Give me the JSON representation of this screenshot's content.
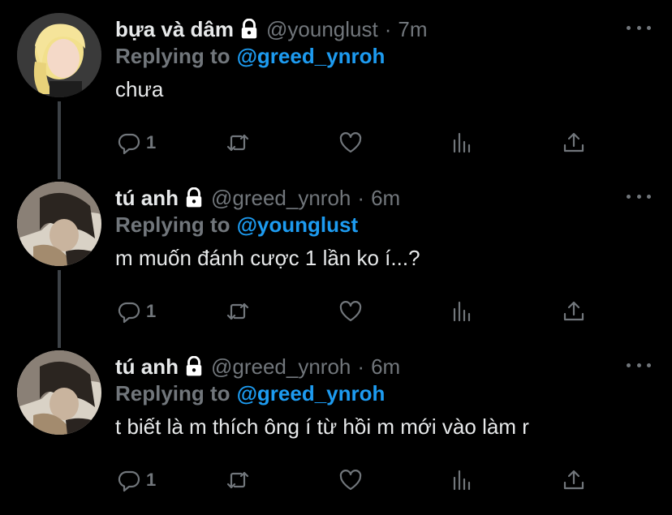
{
  "tweets": [
    {
      "display_name": "bựa và dâm",
      "handle": "@younglust",
      "time": "7m",
      "replying_label": "Replying to",
      "replying_to": "@greed_ynroh",
      "text": "chưa",
      "reply_count": "1",
      "avatar": "blonde-person-avatar"
    },
    {
      "display_name": "tú anh",
      "handle": "@greed_ynroh",
      "time": "6m",
      "replying_label": "Replying to",
      "replying_to": "@younglust",
      "text": "m muốn đánh cược 1 lần ko í...?",
      "reply_count": "1",
      "avatar": "dark-hair-person-avatar"
    },
    {
      "display_name": "tú anh",
      "handle": "@greed_ynroh",
      "time": "6m",
      "replying_label": "Replying to",
      "replying_to": "@greed_ynroh",
      "text": "t biết là m thích ông í từ hồi m mới vào làm r",
      "reply_count": "1",
      "avatar": "dark-hair-person-avatar"
    }
  ],
  "separator": "·",
  "colors": {
    "background": "#000000",
    "text": "#e7e9ea",
    "muted": "#71767b",
    "accent": "#1d9bf0",
    "thread_line": "#3d4247"
  }
}
